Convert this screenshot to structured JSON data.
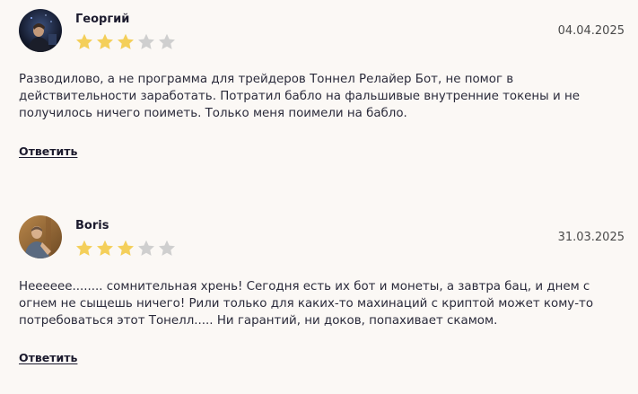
{
  "reviews": [
    {
      "author": "Георгий",
      "date": "04.04.2025",
      "rating": 3,
      "max_rating": 5,
      "text": "Разводилово, а не программа для трейдеров Тоннел Релайер Бот, не помог в действительности заработать. Потратил бабло на фальшивые внутренние токены и не получилось ничего поиметь. Только меня поимели на бабло.",
      "reply_label": "Ответить"
    },
    {
      "author": "Boris",
      "date": "31.03.2025",
      "rating": 3,
      "max_rating": 5,
      "text": "Нееееее........ сомнительная хрень! Сегодня есть их бот и монеты, а завтра бац, и днем с огнем не сыщешь ничего! Рили только для каких-то махинаций с криптой может кому-то потребоваться этот Тонелл..... Ни гарантий, ни доков, попахивает скамом.",
      "reply_label": "Ответить"
    }
  ],
  "colors": {
    "background": "#fbf8f5",
    "star_filled": "#f4cf5a",
    "star_empty": "#cfcfcf",
    "text": "#2a2a3a"
  }
}
